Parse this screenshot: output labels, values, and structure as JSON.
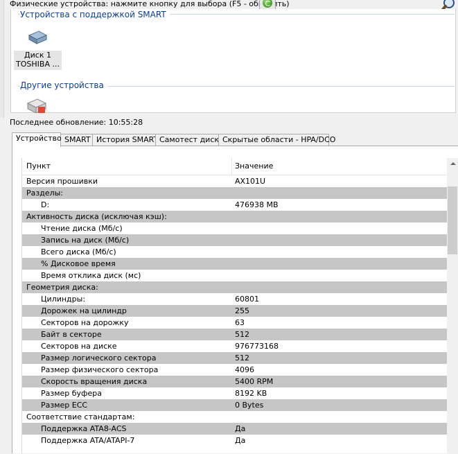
{
  "header": {
    "physical_devices_hint": "Физические устройства: нажмите кнопку для выбора (F5 - обновить)"
  },
  "icons": {
    "refresh": "refresh-icon",
    "search": "search-icon",
    "disk": "hard-disk-icon",
    "other_device": "removable-drive-icon"
  },
  "devices": {
    "smart_group_title": "Устройства с поддержкой SMART",
    "disk": {
      "line1": "Диск 1",
      "line2": "TOSHIBA ..."
    },
    "other_group_title": "Другие устройства"
  },
  "status": {
    "last_update": "Последнее обновление: 10:55:28"
  },
  "tabs": [
    "Устройство",
    "SMART",
    "История SMART",
    "Самотест диска",
    "Скрытые области - HPA/DCO"
  ],
  "active_tab": "Устройство",
  "table": {
    "columns": [
      "Пункт",
      "Значение"
    ],
    "rows": [
      {
        "label": "Версия прошивки",
        "value": "AX101U",
        "indent": false,
        "gray": false
      },
      {
        "label": "Разделы:",
        "value": "",
        "indent": false,
        "gray": true
      },
      {
        "label": "D:",
        "value": "476938 MB",
        "indent": true,
        "gray": false
      },
      {
        "label": "Активность диска (исключая кэш):",
        "value": "",
        "indent": false,
        "gray": true
      },
      {
        "label": "Чтение диска (Мб/с)",
        "value": "",
        "indent": true,
        "gray": false
      },
      {
        "label": "Запись на диск (Мб/с)",
        "value": "",
        "indent": true,
        "gray": true
      },
      {
        "label": "Всего диска (Мб/с)",
        "value": "",
        "indent": true,
        "gray": false
      },
      {
        "label": "% Дисковое время",
        "value": "",
        "indent": true,
        "gray": true
      },
      {
        "label": "Время отклика диск (мс)",
        "value": "",
        "indent": true,
        "gray": false
      },
      {
        "label": "Геометрия диска:",
        "value": "",
        "indent": false,
        "gray": true
      },
      {
        "label": "Цилиндры:",
        "value": "60801",
        "indent": true,
        "gray": false
      },
      {
        "label": "Дорожек на цилиндр",
        "value": "255",
        "indent": true,
        "gray": true
      },
      {
        "label": "Секторов на дорожку",
        "value": "63",
        "indent": true,
        "gray": false
      },
      {
        "label": "Байт в секторе",
        "value": "512",
        "indent": true,
        "gray": true
      },
      {
        "label": "Секторов на диске",
        "value": "976773168",
        "indent": true,
        "gray": false
      },
      {
        "label": "Размер логического сектора",
        "value": "512",
        "indent": true,
        "gray": true
      },
      {
        "label": "Размер физического сектора",
        "value": "4096",
        "indent": true,
        "gray": false
      },
      {
        "label": "Скорость вращения диска",
        "value": "5400 RPM",
        "indent": true,
        "gray": true
      },
      {
        "label": "Размер буфера",
        "value": "8192 KB",
        "indent": true,
        "gray": false
      },
      {
        "label": "Размер ECC",
        "value": "0 Bytes",
        "indent": true,
        "gray": true
      },
      {
        "label": "Соответствие стандартам:",
        "value": "",
        "indent": false,
        "gray": false
      },
      {
        "label": "Поддержка ATA8-ACS",
        "value": "Да",
        "indent": true,
        "gray": true
      },
      {
        "label": "Поддержка ATA/ATAPI-7",
        "value": "Да",
        "indent": true,
        "gray": false
      }
    ]
  }
}
